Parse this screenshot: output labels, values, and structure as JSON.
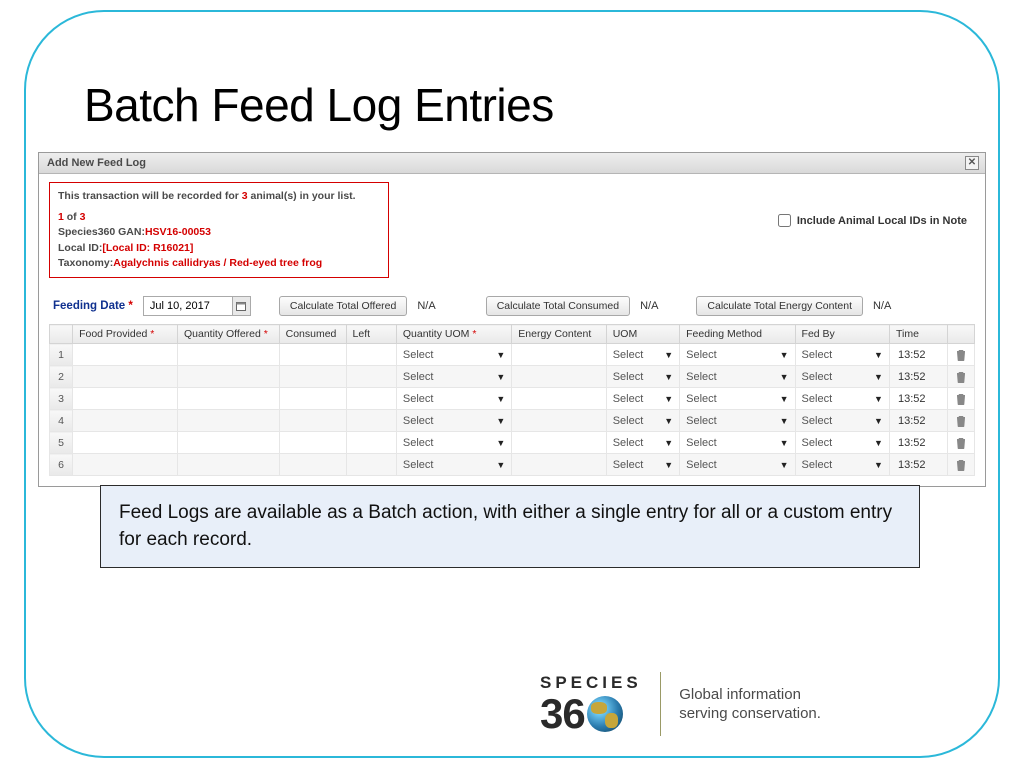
{
  "title": "Batch Feed Log Entries",
  "dialog": {
    "header": "Add New Feed Log",
    "info": {
      "line1_a": "This transaction will be recorded for ",
      "line1_b": "3",
      "line1_c": " animal(s) in your list.",
      "count_a": "1",
      "count_b": " of ",
      "count_c": "3",
      "gan_label": "Species360 GAN:",
      "gan_value": "HSV16-00053",
      "localid_label": "Local ID:",
      "localid_value": "[Local ID: R16021]",
      "tax_label": "Taxonomy:",
      "tax_value": "Agalychnis callidryas / Red-eyed tree frog"
    },
    "include_label": "Include Animal Local IDs in Note",
    "feeding_date_label": "Feeding Date",
    "feeding_date_value": "Jul 10, 2017",
    "calc_offered": "Calculate Total Offered",
    "calc_consumed": "Calculate Total Consumed",
    "calc_energy": "Calculate Total Energy Content",
    "na": "N/A"
  },
  "columns": {
    "food": "Food Provided",
    "qty_offered": "Quantity Offered",
    "consumed": "Consumed",
    "left": "Left",
    "qty_uom": "Quantity UOM",
    "energy": "Energy Content",
    "uom": "UOM",
    "method": "Feeding Method",
    "fedby": "Fed By",
    "time": "Time"
  },
  "select_text": "Select",
  "rows": [
    {
      "n": "1",
      "time": "13:52"
    },
    {
      "n": "2",
      "time": "13:52"
    },
    {
      "n": "3",
      "time": "13:52"
    },
    {
      "n": "4",
      "time": "13:52"
    },
    {
      "n": "5",
      "time": "13:52"
    },
    {
      "n": "6",
      "time": "13:52"
    }
  ],
  "caption": "Feed Logs are available as a Batch action, with either a single entry for all or a custom entry for each record.",
  "logo": {
    "line1": "SPECIES",
    "d3": "3",
    "d6": "6",
    "d0": "0",
    "tagline1": "Global information",
    "tagline2": "serving conservation."
  }
}
